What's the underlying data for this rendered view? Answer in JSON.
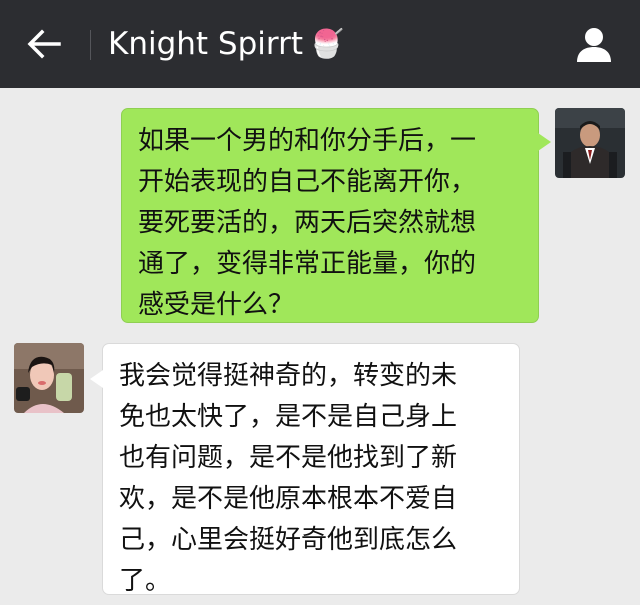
{
  "header": {
    "title": "Knight Spirrt",
    "title_emoji": "🍧",
    "back_icon": "arrow-left-icon",
    "profile_icon": "person-icon"
  },
  "colors": {
    "topbar": "#2c2d31",
    "background": "#ebebeb",
    "outgoing_bubble": "#a0e75a",
    "incoming_bubble": "#ffffff"
  },
  "messages": [
    {
      "direction": "outgoing",
      "text": "如果一个男的和你分手后，一\n开始表现的自己不能离开你，\n要死要活的，两天后突然就想\n通了，变得非常正能量，你的\n感受是什么？"
    },
    {
      "direction": "incoming",
      "text": "我会觉得挺神奇的，转变的未\n免也太快了，是不是自己身上\n也有问题，是不是他找到了新\n欢，是不是他原本根本不爱自\n己，心里会挺好奇他到底怎么\n了。"
    }
  ]
}
